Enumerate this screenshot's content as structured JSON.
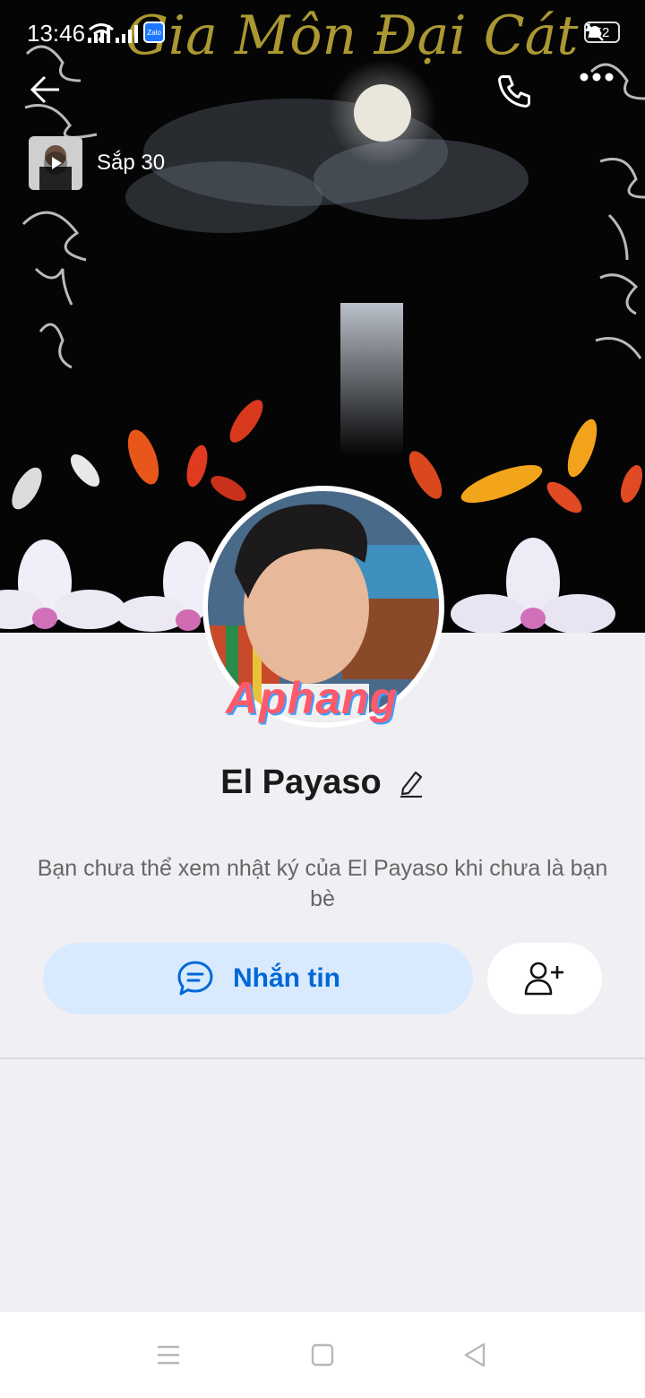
{
  "status_bar": {
    "time": "13:46",
    "battery": "52",
    "zalo_badge": "Zalo"
  },
  "cover": {
    "calligraphy_title": "Gia Môn Đại Cát"
  },
  "story": {
    "label": "Sắp 30"
  },
  "profile": {
    "name": "El Payaso",
    "watermark": "Aphang",
    "info_text": "Bạn chưa thể xem nhật ký của El Payaso khi chưa là bạn bè"
  },
  "actions": {
    "message_label": "Nhắn tin"
  },
  "colors": {
    "accent": "#0068d6",
    "button_bg": "#d9eaff",
    "page_bg": "#f0f0f4"
  },
  "icons": [
    "back-arrow-icon",
    "phone-icon",
    "more-icon",
    "play-icon",
    "edit-icon",
    "chat-icon",
    "add-friend-icon",
    "recent-apps-icon",
    "home-icon",
    "back-icon"
  ]
}
